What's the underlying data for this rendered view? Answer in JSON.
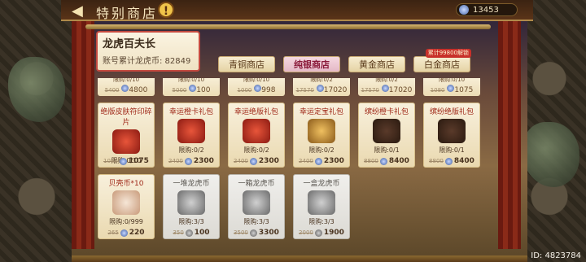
{
  "header": {
    "title": "特别商店",
    "back_icon": "back-arrow-icon",
    "info_icon": "info-icon",
    "currency_amount": "13453"
  },
  "rank": {
    "title": "龙虎百夫长",
    "subtitle": "账号累计龙虎币: 82849"
  },
  "tabs": [
    {
      "label": "青铜商店",
      "active": false
    },
    {
      "label": "纯银商店",
      "active": true
    },
    {
      "label": "黄金商店",
      "active": false
    },
    {
      "label": "白金商店",
      "active": false,
      "badge": "累计99800解锁"
    }
  ],
  "partial_row": [
    {
      "limit": "限购:0/10",
      "old": "5400",
      "price": "4800"
    },
    {
      "limit": "限购:0/10",
      "old": "5000",
      "price": "100"
    },
    {
      "limit": "限购:0/10",
      "old": "1000",
      "price": "998"
    },
    {
      "limit": "限购:0/2",
      "old": "17570",
      "price": "17020"
    },
    {
      "limit": "限购:0/2",
      "old": "17570",
      "price": "17020"
    },
    {
      "limit": "限购:0/10",
      "old": "1080",
      "price": "1075"
    }
  ],
  "row1": [
    {
      "name": "绝版皮肤符印碎片",
      "limit": "限购:0/10",
      "old": "1080",
      "price": "1075",
      "art": "red",
      "coin": "silver"
    },
    {
      "name": "幸运橙卡礼包",
      "limit": "限购:0/2",
      "old": "2400",
      "price": "2300",
      "art": "red",
      "coin": "silver"
    },
    {
      "name": "幸运绝版礼包",
      "limit": "限购:0/2",
      "old": "2400",
      "price": "2300",
      "art": "red",
      "coin": "silver"
    },
    {
      "name": "幸运定宝礼包",
      "limit": "限购:0/2",
      "old": "2400",
      "price": "2300",
      "art": "gold",
      "coin": "silver"
    },
    {
      "name": "缤纷橙卡礼包",
      "limit": "限购:0/1",
      "old": "8800",
      "price": "8400",
      "art": "dark",
      "coin": "silver"
    },
    {
      "name": "缤纷绝版礼包",
      "limit": "限购:0/1",
      "old": "8800",
      "price": "8400",
      "art": "dark",
      "coin": "silver"
    }
  ],
  "row2": [
    {
      "name": "贝壳币*10",
      "limit": "限购:0/999",
      "old": "265",
      "price": "220",
      "art": "shell",
      "coin": "silver",
      "gray": false
    },
    {
      "name": "一堆龙虎币",
      "limit": "限购:3/3",
      "old": "350",
      "price": "100",
      "art": "gray",
      "coin": "gray",
      "gray": true
    },
    {
      "name": "一箱龙虎币",
      "limit": "限购:3/3",
      "old": "3500",
      "price": "3300",
      "art": "gray",
      "coin": "gray",
      "gray": true
    },
    {
      "name": "一盒龙虎币",
      "limit": "限购:3/3",
      "old": "2000",
      "price": "1900",
      "art": "gray",
      "coin": "gray",
      "gray": true
    }
  ],
  "footer": {
    "id_text": "ID: 4823784"
  }
}
